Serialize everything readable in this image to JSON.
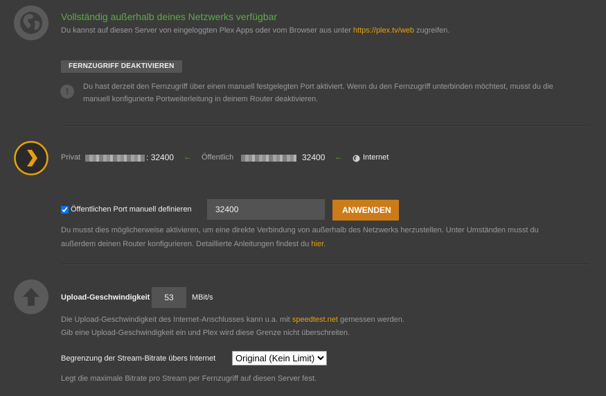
{
  "remote": {
    "status_title": "Vollständig außerhalb deines Netzwerks verfügbar",
    "status_desc_before": "Du kannst auf diesen Server von eingeloggten Plex Apps oder vom Browser aus unter ",
    "status_link": "https://plex.tv/web",
    "status_desc_after": " zugreifen.",
    "disable_button": "FERNZUGRIFF DEAKTIVIEREN",
    "warning_line1": "Du hast derzeit den Fernzugriff über einen manuell festgelegten Port aktiviert. Wenn du den Fernzugriff unterbinden möchtest, musst du die",
    "warning_line2": "manuell konfigurierte Portweiterleitung in deinem Router deaktivieren."
  },
  "connection": {
    "private_label": "Privat",
    "private_sep": ":",
    "private_port": "32400",
    "public_label": "Öffentlich",
    "public_port": "32400",
    "internet_label": "Internet"
  },
  "port": {
    "checkbox_label": "Öffentlichen Port manuell definieren",
    "checked": true,
    "value": "32400",
    "apply_button": "ANWENDEN",
    "help_line1": "Du musst dies möglicherweise aktivieren, um eine direkte Verbindung von außerhalb des Netzwerks herzustellen. Unter Umständen musst du",
    "help_line2_before": "außerdem deinen Router konfigurieren. Detaillierte Anleitungen findest du ",
    "help_link": "hier",
    "help_line2_after": "."
  },
  "upload": {
    "label": "Upload-Geschwindigkeit",
    "value": "53",
    "unit": "MBit/s",
    "help_line1_before": "Die Upload-Geschwindigkeit des Internet-Anschlusses kann u.a. mit ",
    "help_link": "speedtest.net",
    "help_line1_after": " gemessen werden.",
    "help_line2": "Gib eine Upload-Geschwindigkeit ein und Plex wird diese Grenze nicht überschreiten."
  },
  "bitrate": {
    "label": "Begrenzung der Stream-Bitrate übers Internet",
    "selected": "Original (Kein Limit)",
    "help": "Legt die maximale Bitrate pro Stream per Fernzugriff auf diesen Server fest."
  },
  "colors": {
    "accent": "#e5a00d",
    "success": "#5fa94a",
    "background": "#3b3b3b"
  },
  "icons": [
    "globe-icon",
    "warning-icon",
    "plex-chevron-icon",
    "arrow-left-icon",
    "globe-small-icon",
    "upload-arrow-icon"
  ]
}
